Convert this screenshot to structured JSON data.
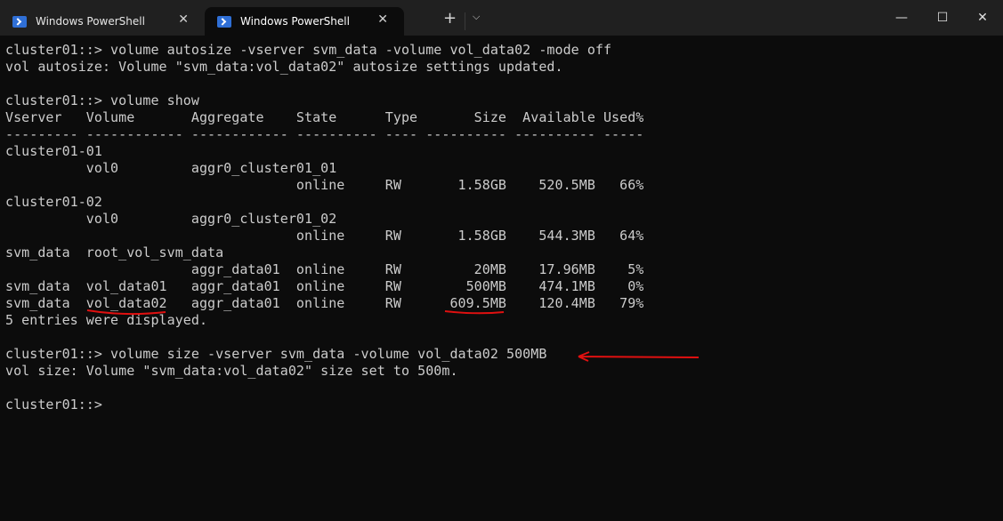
{
  "tabs": [
    {
      "label": "Windows PowerShell",
      "icon": "powershell-icon",
      "active": false
    },
    {
      "label": "Windows PowerShell",
      "icon": "powershell-icon",
      "active": true
    }
  ],
  "titlebar": {
    "new_tab": "+",
    "dropdown": "⌵",
    "minimize": "—",
    "maximize": "☐",
    "close": "✕",
    "tab_close": "✕"
  },
  "terminal": {
    "lines": [
      "cluster01::> volume autosize -vserver svm_data -volume vol_data02 -mode off",
      "vol autosize: Volume \"svm_data:vol_data02\" autosize settings updated.",
      "",
      "cluster01::> volume show",
      "Vserver   Volume       Aggregate    State      Type       Size  Available Used%",
      "--------- ------------ ------------ ---------- ---- ---------- ---------- -----",
      "cluster01-01",
      "          vol0         aggr0_cluster01_01",
      "                                    online     RW       1.58GB    520.5MB   66%",
      "cluster01-02",
      "          vol0         aggr0_cluster01_02",
      "                                    online     RW       1.58GB    544.3MB   64%",
      "svm_data  root_vol_svm_data",
      "                       aggr_data01  online     RW         20MB    17.96MB    5%",
      "svm_data  vol_data01   aggr_data01  online     RW        500MB    474.1MB    0%",
      "svm_data  vol_data02   aggr_data01  online     RW      609.5MB    120.4MB   79%",
      "5 entries were displayed.",
      "",
      "cluster01::> volume size -vserver svm_data -volume vol_data02 500MB",
      "vol size: Volume \"svm_data:vol_data02\" size set to 500m.",
      "",
      "cluster01::> "
    ]
  },
  "colors": {
    "annotation": "#e01010",
    "text": "#cccccc",
    "background": "#0c0c0c"
  }
}
